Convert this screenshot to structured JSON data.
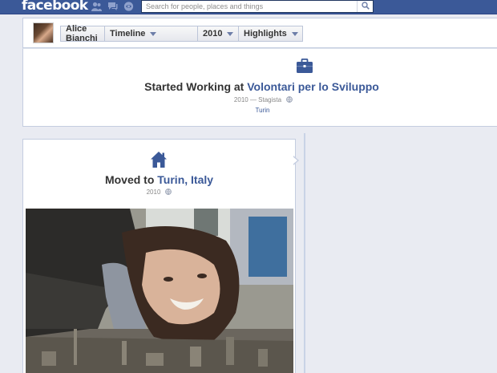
{
  "topbar": {
    "logo": "facebook",
    "search_placeholder": "Search for people, places and things",
    "jewels": [
      "friend-requests-icon",
      "messages-icon",
      "notifications-icon"
    ],
    "search_icon": "search-icon"
  },
  "scrubber": {
    "name": "Alice Bianchi",
    "timeline_label": "Timeline",
    "year_label": "2010",
    "filter_label": "Highlights"
  },
  "work_event": {
    "icon": "briefcase-icon",
    "title_prefix": "Started Working at",
    "organization": "Volontari per lo Sviluppo",
    "meta": "2010 — Stagista",
    "location": "Turin"
  },
  "move_event": {
    "icon": "house-icon",
    "title_prefix": "Moved to",
    "place": "Turin, Italy",
    "meta": "2010"
  },
  "colors": {
    "brand": "#3b5998",
    "link": "#3b5998",
    "page_bg": "#e9ebf2",
    "card_border": "#c4cde0"
  }
}
